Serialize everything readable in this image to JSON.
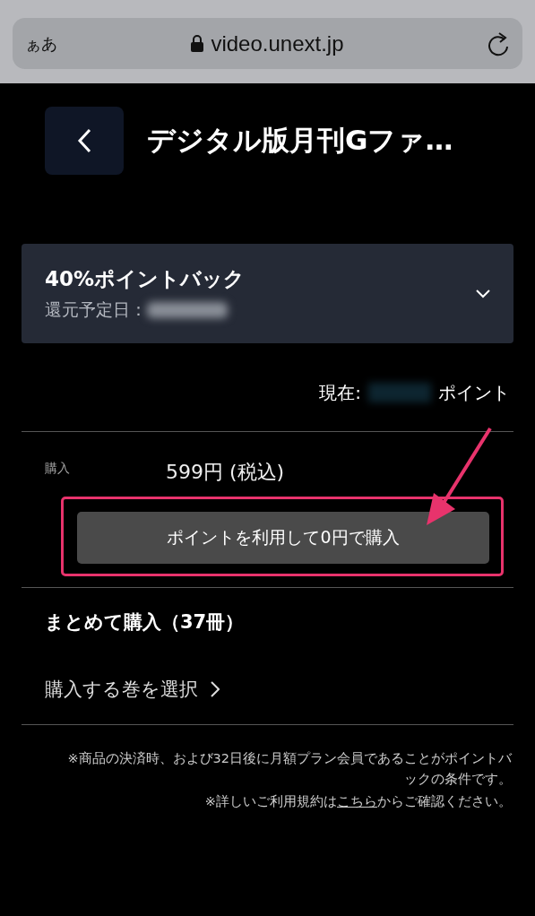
{
  "browser": {
    "text_size_button": "ぁあ",
    "url": "video.unext.jp"
  },
  "header": {
    "title": "デジタル版月刊Gファ…"
  },
  "pointback": {
    "title": "40%ポイントバック",
    "date_label": "還元予定日：",
    "expanded": false
  },
  "points": {
    "prefix": "現在:",
    "suffix": "ポイント"
  },
  "purchase": {
    "label": "購入",
    "price": "599円 (税込)",
    "button": "ポイントを利用して0円で購入"
  },
  "bulk": {
    "title": "まとめて購入（37冊）",
    "select": "購入する巻を選択"
  },
  "notes": [
    {
      "text": "※商品の決済時、および32日後に月額プラン会員であることがポイントバックの条件です。"
    },
    {
      "before": "※詳しいご利用規約は",
      "link": "こちら",
      "after": "からご確認ください。"
    }
  ]
}
